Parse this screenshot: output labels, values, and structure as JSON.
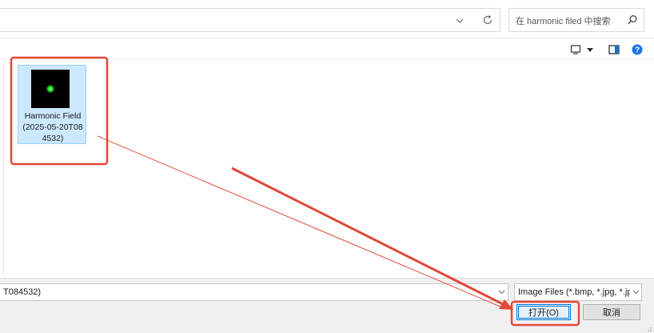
{
  "address_bar": {
    "path": "",
    "dropdown_icon": "chevron-down-icon",
    "refresh_icon": "refresh-icon"
  },
  "search": {
    "placeholder": "在 harmonic filed 中搜索",
    "icon": "search-icon"
  },
  "toolbar": {
    "view_icon": "view-options-icon",
    "view_dropdown_icon": "caret-down-icon",
    "preview_pane_icon": "preview-pane-icon",
    "help_icon": "help-icon",
    "help_label": "?"
  },
  "files": [
    {
      "name_lines": [
        "Harmonic Field",
        "(2025-05-20T08",
        "4532)"
      ],
      "selected": true,
      "thumbnail": "green-glow-thumbnail"
    }
  ],
  "bottom": {
    "filename_value": "T084532)",
    "filter_value": "Image Files (*.bmp, *.jpg, *.jpeg",
    "open_label": "打开(O)",
    "cancel_label": "取消"
  },
  "annotations": {
    "highlight_color": "#e0483a",
    "targets": [
      "selected-file",
      "open-button"
    ]
  },
  "colors": {
    "selection_bg": "#cce8ff",
    "selection_border": "#99d1ff",
    "accent": "#0078d7",
    "help_blue": "#1a73e8"
  }
}
